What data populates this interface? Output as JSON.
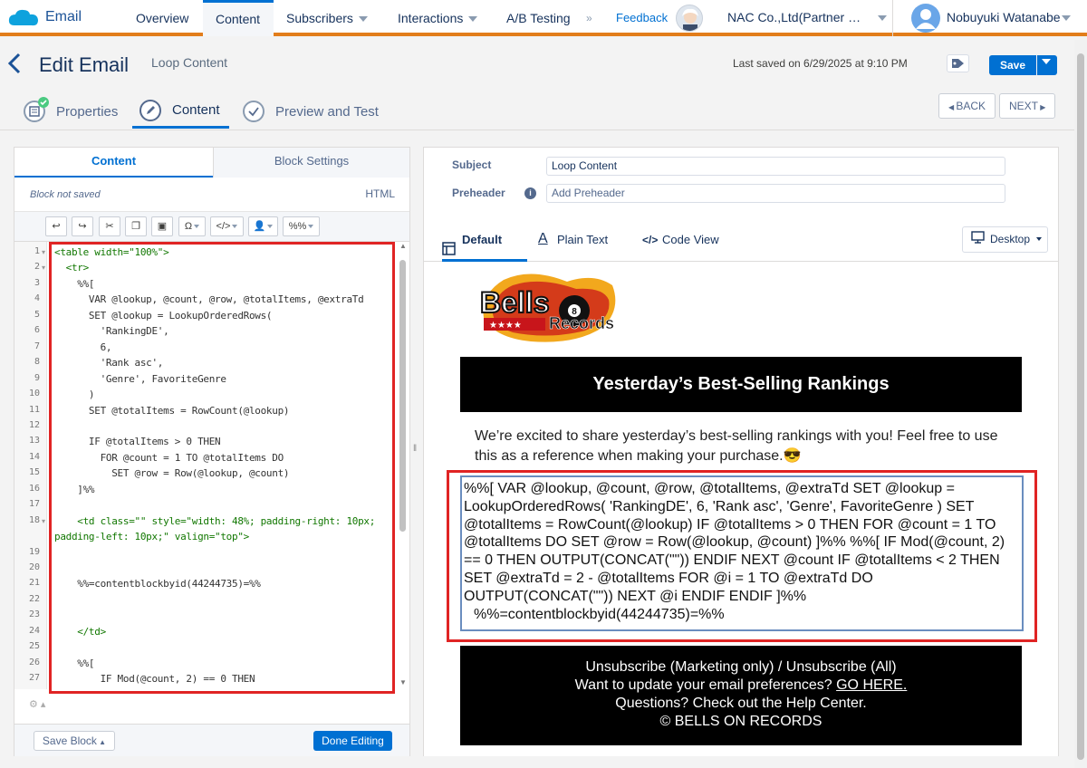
{
  "nav": {
    "app_name": "Email",
    "items": [
      "Overview",
      "Content",
      "Subscribers",
      "Interactions",
      "A/B Testing"
    ],
    "feedback": "Feedback",
    "company": "NAC Co.,Ltd(Partner M...",
    "user": "Nobuyuki Watanabe"
  },
  "header": {
    "title": "Edit Email",
    "subtitle": "Loop Content",
    "last_saved": "Last saved on 6/29/2025 at 9:10 PM",
    "save_label": "Save"
  },
  "steps": {
    "items": [
      "Properties",
      "Content",
      "Preview and Test"
    ],
    "back": "BACK",
    "next": "NEXT"
  },
  "left": {
    "tabs": [
      "Content",
      "Block Settings"
    ],
    "status": "Block not saved",
    "mode": "HTML",
    "toolbar": {
      "omega": "Ω",
      "code": "</>",
      "ampscript": "%%"
    },
    "code_lines": [
      {
        "n": "1",
        "text": "<table width=\"100%\">",
        "cls": "tag",
        "fold": true
      },
      {
        "n": "2",
        "text": "  <tr>",
        "cls": "tag",
        "fold": true
      },
      {
        "n": "3",
        "text": "    %%[",
        "cls": "",
        "fold": false
      },
      {
        "n": "4",
        "text": "      VAR @lookup, @count, @row, @totalItems, @extraTd",
        "cls": "",
        "fold": false
      },
      {
        "n": "5",
        "text": "      SET @lookup = LookupOrderedRows(",
        "cls": "",
        "fold": false
      },
      {
        "n": "6",
        "text": "        'RankingDE',",
        "cls": "",
        "fold": false
      },
      {
        "n": "7",
        "text": "        6,",
        "cls": "",
        "fold": false
      },
      {
        "n": "8",
        "text": "        'Rank asc',",
        "cls": "",
        "fold": false
      },
      {
        "n": "9",
        "text": "        'Genre', FavoriteGenre",
        "cls": "",
        "fold": false
      },
      {
        "n": "10",
        "text": "      )",
        "cls": "",
        "fold": false
      },
      {
        "n": "11",
        "text": "      SET @totalItems = RowCount(@lookup)",
        "cls": "",
        "fold": false
      },
      {
        "n": "12",
        "text": "",
        "cls": "",
        "fold": false
      },
      {
        "n": "13",
        "text": "      IF @totalItems > 0 THEN",
        "cls": "",
        "fold": false
      },
      {
        "n": "14",
        "text": "        FOR @count = 1 TO @totalItems DO",
        "cls": "",
        "fold": false
      },
      {
        "n": "15",
        "text": "          SET @row = Row(@lookup, @count)",
        "cls": "",
        "fold": false
      },
      {
        "n": "16",
        "text": "    ]%%",
        "cls": "",
        "fold": false
      },
      {
        "n": "17",
        "text": "",
        "cls": "",
        "fold": false
      },
      {
        "n": "18",
        "text": "    <td class=\"\" style=\"width: 48%; padding-right: 10px;",
        "cls": "tag",
        "fold": true
      },
      {
        "n": "",
        "text": "padding-left: 10px;\" valign=\"top\">",
        "cls": "tag",
        "fold": false
      },
      {
        "n": "19",
        "text": "",
        "cls": "",
        "fold": false
      },
      {
        "n": "20",
        "text": "",
        "cls": "",
        "fold": false
      },
      {
        "n": "21",
        "text": "    %%=contentblockbyid(44244735)=%%",
        "cls": "",
        "fold": false
      },
      {
        "n": "22",
        "text": "",
        "cls": "",
        "fold": false
      },
      {
        "n": "23",
        "text": "",
        "cls": "",
        "fold": false
      },
      {
        "n": "24",
        "text": "    </td>",
        "cls": "tag",
        "fold": false
      },
      {
        "n": "25",
        "text": "",
        "cls": "",
        "fold": false
      },
      {
        "n": "26",
        "text": "    %%[",
        "cls": "",
        "fold": false
      },
      {
        "n": "27",
        "text": "        IF Mod(@count, 2) == 0 THEN",
        "cls": "",
        "fold": false
      }
    ],
    "save_block": "Save Block",
    "done": "Done Editing"
  },
  "right": {
    "subject_label": "Subject",
    "subject_value": "Loop Content",
    "preheader_label": "Preheader",
    "preheader_placeholder": "Add Preheader",
    "tabs": [
      "Default",
      "Plain Text",
      "Code View"
    ],
    "device": "Desktop",
    "email": {
      "logo_line1": "Bells",
      "logo_line2": "Records",
      "banner": "Yesterday’s Best-Selling Rankings",
      "intro": "We’re excited to share yesterday’s best-selling rankings with you! Feel free to use this as a reference when making your purchase.😎",
      "ampscript": "%%[ VAR @lookup, @count, @row, @totalItems, @extraTd SET @lookup = LookupOrderedRows( 'RankingDE', 6, 'Rank asc', 'Genre', FavoriteGenre ) SET @totalItems = RowCount(@lookup) IF @totalItems > 0 THEN FOR @count = 1 TO @totalItems DO SET @row = Row(@lookup, @count) ]%% %%[ IF Mod(@count, 2) == 0 THEN OUTPUT(CONCAT(\"\")) ENDIF NEXT @count IF @totalItems < 2 THEN SET @extraTd = 2 - @totalItems FOR @i = 1 TO @extraTd DO OUTPUT(CONCAT(\"\")) NEXT @i ENDIF ENDIF ]%%",
      "ampscript_line2": "%%=contentblockbyid(44244735)=%%",
      "footer_line1": "Unsubscribe (Marketing only) / Unsubscribe (All)",
      "footer_line2_text": "Want to update your email preferences? ",
      "footer_line2_link": "GO HERE.",
      "footer_line3": "Questions? Check out the Help Center.",
      "footer_line4": "© BELLS ON RECORDS"
    }
  }
}
